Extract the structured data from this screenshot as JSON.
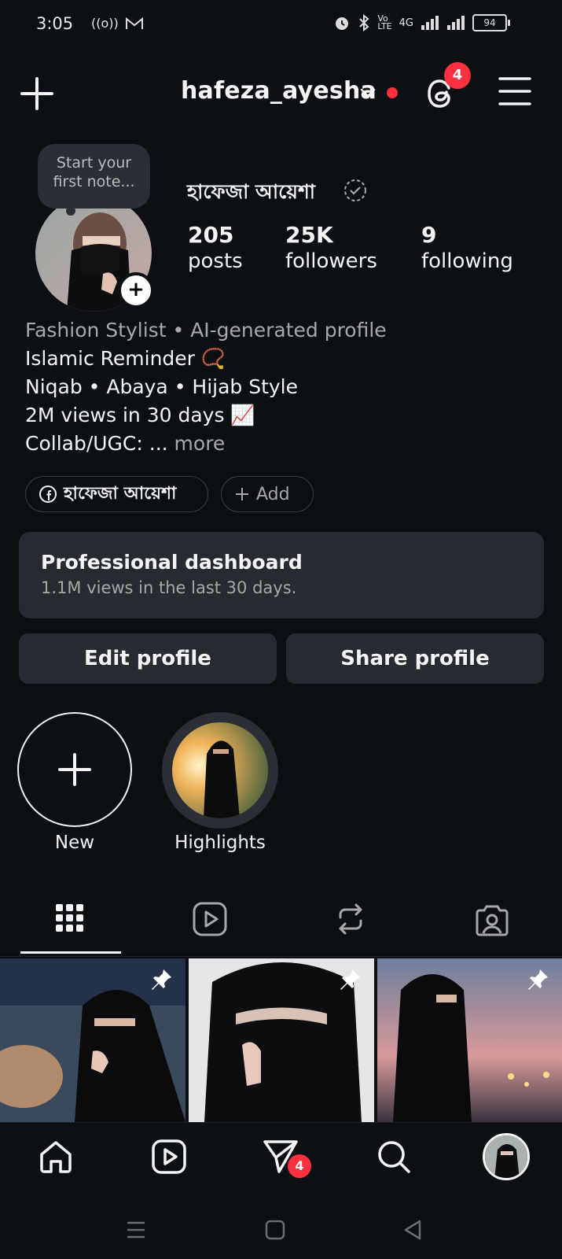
{
  "status_bar": {
    "time": "3:05",
    "battery": "94",
    "network": "4G"
  },
  "header": {
    "username": "hafeza_ayesha",
    "threads_badge": "4"
  },
  "profile": {
    "note_placeholder_line1": "Start your",
    "note_placeholder_line2": "first note...",
    "display_name": "হাফেজা আয়েশা",
    "stats": {
      "posts_count": "205",
      "posts_label": "posts",
      "followers_count": "25K",
      "followers_label": "followers",
      "following_count": "9",
      "following_label": "following"
    },
    "bio": {
      "category": "Fashion Stylist • AI-generated profile",
      "line1": "Islamic Reminder 📿",
      "line2": "Niqab • Abaya • Hijab Style",
      "line3": "2M views in 30 days 📈",
      "line4": "Collab/UGC: ...",
      "more": "more"
    },
    "facebook_link": "হাফেজা আয়েশা",
    "add_label": "Add"
  },
  "dashboard": {
    "title": "Professional dashboard",
    "subtitle": "1.1M views in the last 30 days."
  },
  "actions": {
    "edit_profile": "Edit profile",
    "share_profile": "Share profile"
  },
  "highlights": [
    {
      "label": "New"
    },
    {
      "label": "Highlights"
    }
  ],
  "bottom_nav": {
    "messages_badge": "4"
  },
  "colors": {
    "background": "#0c1014",
    "surface": "#262a31",
    "badge": "#ff3040",
    "muted_text": "#a8a8a8"
  }
}
